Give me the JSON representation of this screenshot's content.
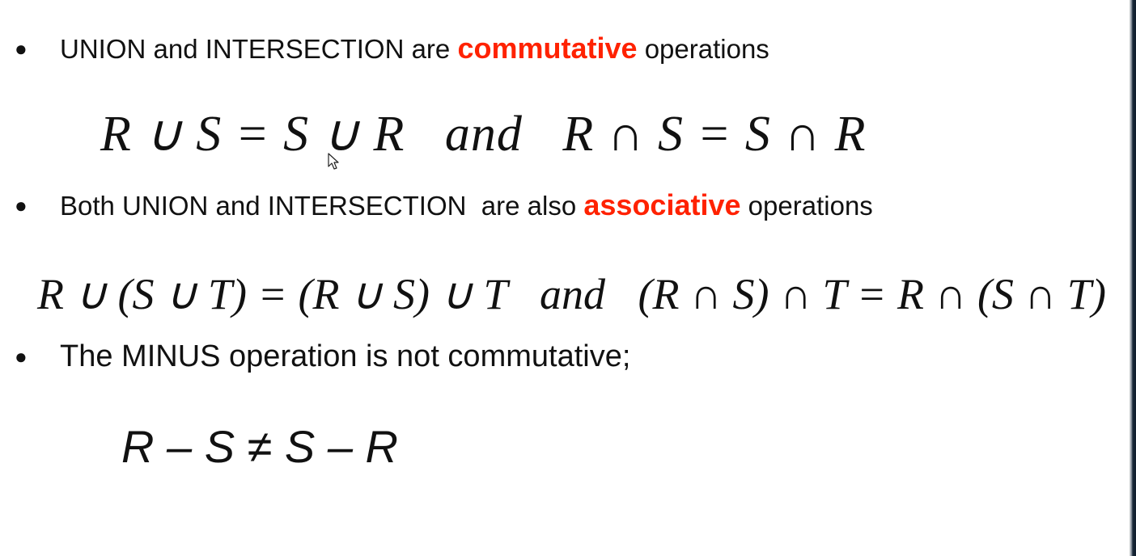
{
  "bullets": [
    {
      "marker": "●",
      "pre": "UNION and INTERSECTION are ",
      "emphasis": "commutative",
      "post": " operations"
    },
    {
      "marker": "●",
      "pre": "Both UNION and INTERSECTION  are also ",
      "emphasis": "associative",
      "post": " operations"
    },
    {
      "marker": "●",
      "pre": "The MINUS operation is not commutative;",
      "emphasis": "",
      "post": ""
    }
  ],
  "formulas": {
    "commutative": "R ∪ S = S ∪ R   and   R ∩ S = S ∩ R",
    "associative": "R ∪ (S ∪ T) = (R ∪ S) ∪ T   and   (R ∩ S) ∩ T = R ∩ (S ∩ T)",
    "minus": "R – S ≠ S – R"
  },
  "colors": {
    "emphasis": "#ff2200",
    "text": "#111111",
    "background": "#ffffff"
  },
  "icons": {
    "cursor": "mouse-pointer-icon",
    "bullet": "bullet-dot-icon"
  }
}
